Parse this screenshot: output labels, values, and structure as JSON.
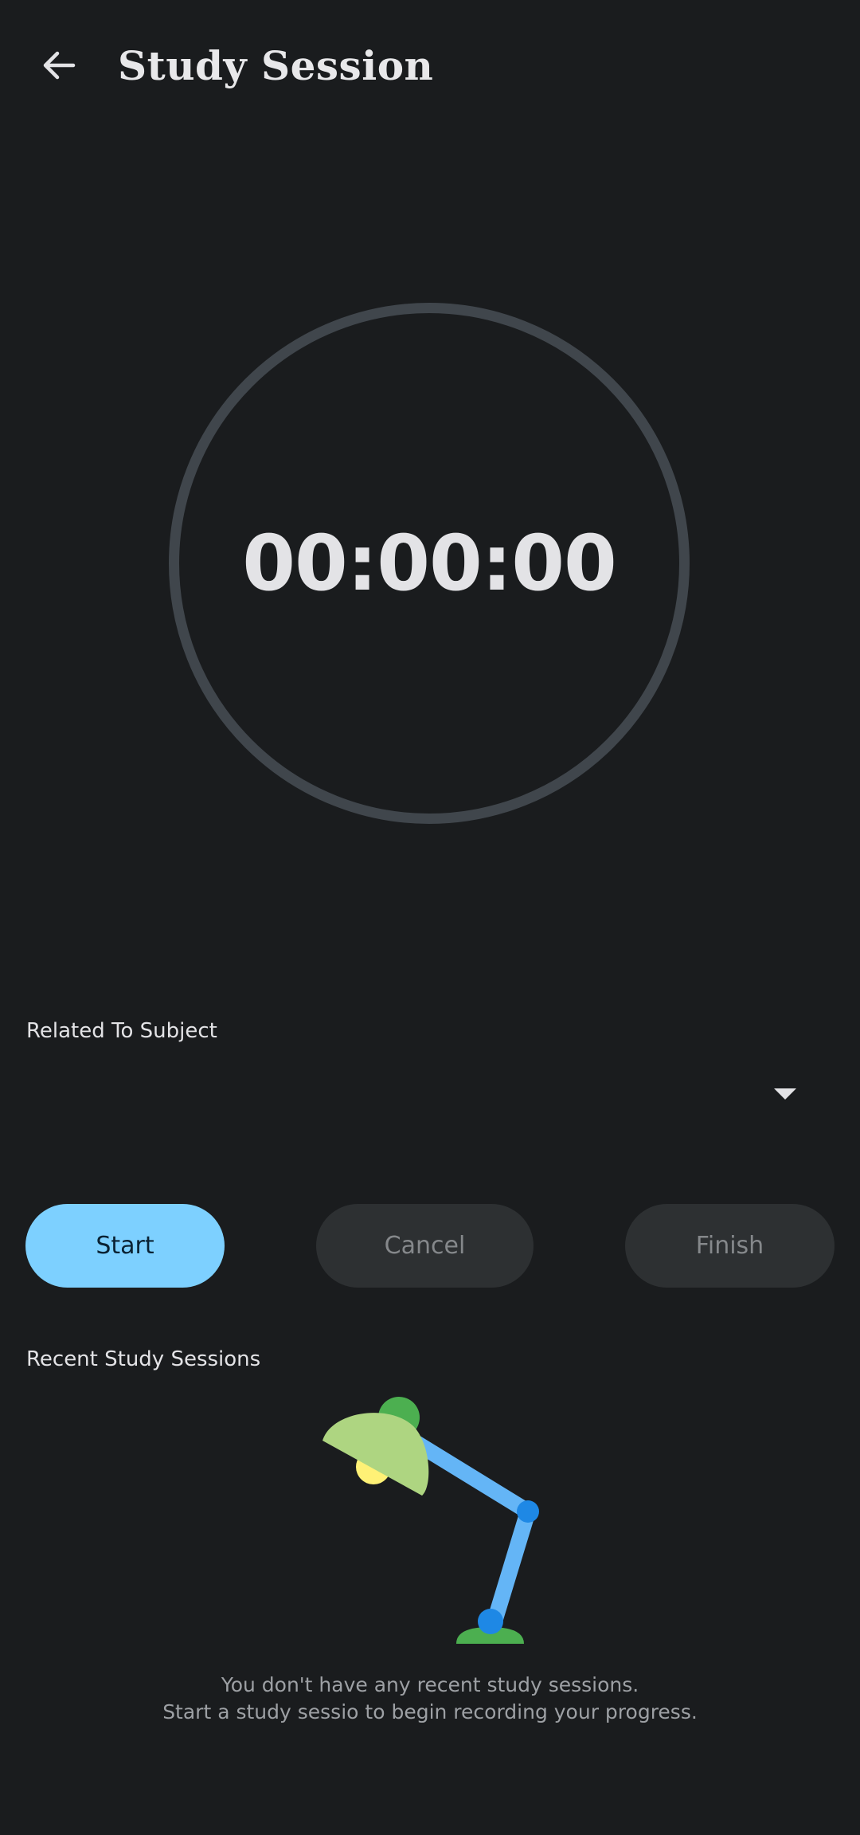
{
  "header": {
    "title": "Study Session"
  },
  "timer": {
    "display": "00:00:00"
  },
  "subject": {
    "label": "Related To Subject",
    "selected_value": ""
  },
  "actions": {
    "start_label": "Start",
    "cancel_label": "Cancel",
    "finish_label": "Finish"
  },
  "recent": {
    "heading": "Recent Study Sessions",
    "empty_line1": "You don't have any recent study sessions.",
    "empty_line2": "Start a study sessio to begin recording your progress."
  },
  "icons": {
    "back": "arrow-back-icon",
    "dropdown": "dropdown-arrow-icon",
    "illustration": "desk-lamp-illustration"
  },
  "colors": {
    "background": "#1a1c1e",
    "ring": "#40464c",
    "start_button": "#7dd0ff",
    "disabled_button": "#2d3032",
    "lamp_shade": "#aed581",
    "lamp_arm": "#64b5f6",
    "lamp_base": "#4caf50",
    "lamp_joint": "#1e88e5",
    "lamp_bulb": "#fff176"
  }
}
